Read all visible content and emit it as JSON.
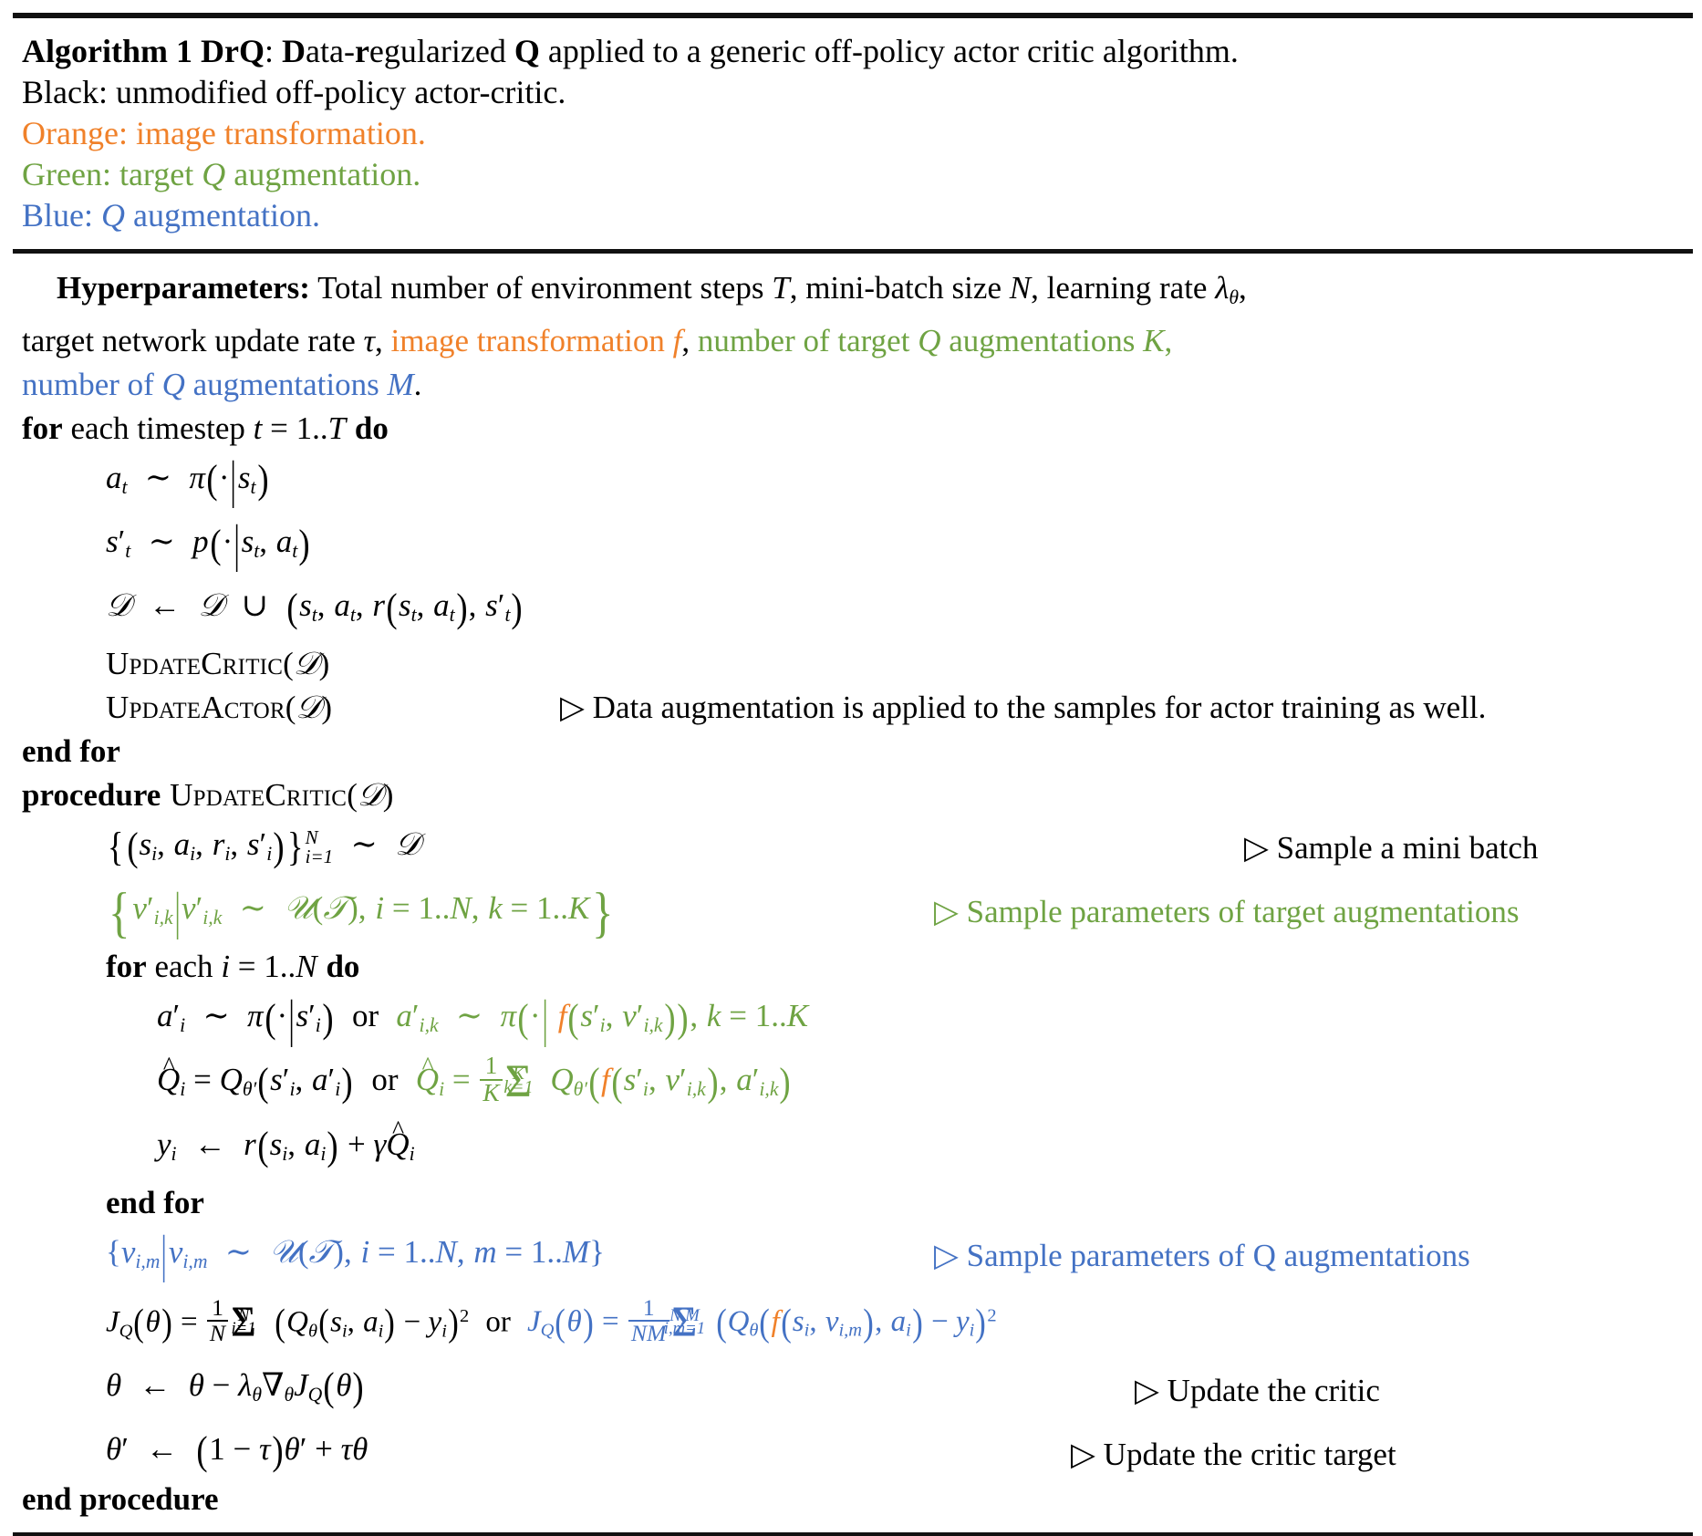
{
  "colors": {
    "black": "#000000",
    "orange": "#f0812a",
    "green": "#6fa343",
    "blue": "#4472c4",
    "rule": "#111111"
  },
  "header": {
    "title_bold_1": "Algorithm 1 DrQ",
    "title_colon": ":",
    "title_D": "D",
    "title_ata_dash": "ata-",
    "title_r": "r",
    "title_egularized": "egularized ",
    "title_Q": "Q",
    "title_rest": " applied to a generic off-policy actor critic algorithm.",
    "legend_black": "Black: unmodified off-policy actor-critic.",
    "legend_orange": "Orange: image transformation.",
    "legend_green_pre": "Green: target ",
    "legend_green_Q": "Q",
    "legend_green_post": " augmentation.",
    "legend_blue_pre": "Blue: ",
    "legend_blue_Q": "Q",
    "legend_blue_post": " augmentation."
  },
  "hyperparameters": {
    "label": "Hyperparameters:",
    "text_1": " Total number of environment steps ",
    "sym_T": "T",
    "text_2": ", mini-batch size ",
    "sym_N": "N",
    "text_3": ", learning rate ",
    "sym_lambda": "λ",
    "sym_lambda_sub": "θ",
    "text_4": ",",
    "text_5": "target network update rate ",
    "sym_tau": "τ",
    "text_6": ", ",
    "orange_text": "image transformation ",
    "orange_f": "f",
    "text_7": ", ",
    "green_text_a": "number of target ",
    "green_Q": "Q",
    "green_text_b": " augmentations ",
    "green_K": "K",
    "text_8": ",",
    "blue_text_a": "number of ",
    "blue_Q": "Q",
    "blue_text_b": " augmentations ",
    "blue_M": "M",
    "text_9": "."
  },
  "lines": {
    "for_timestep": {
      "kw_for": "for",
      "mid": " each timestep ",
      "t": "t",
      "eq": " = 1..",
      "T": "T",
      "kw_do": "do"
    },
    "a_t_sample": "a_t ~ π(·|s_t)",
    "s_t_sample": "s'_t ~ p(·|s_t, a_t)",
    "replay_update": "D ← D ∪ (s_t, a_t, r(s_t, a_t), s'_t)",
    "update_critic_call": "UPDATECRITIC(D)",
    "update_actor_call": "UPDATEACTOR(D)",
    "update_actor_comment": "Data augmentation is applied to the samples for actor training as well.",
    "end_for_1": "end for",
    "procedure_kw": "procedure",
    "procedure_name": "UpdateCritic",
    "procedure_arg": "(D)",
    "minibatch": "{(s_i, a_i, r_i, s'_i)}^N_{i=1} ~ D",
    "minibatch_comment": "Sample a mini batch",
    "target_aug_sample": "{ν'_{i,k} | ν'_{i,k} ~ U(T), i = 1..N, k = 1..K}",
    "target_aug_comment": "Sample parameters of target augmentations",
    "for_each_i": {
      "kw_for": "for",
      "mid": " each ",
      "i": "i",
      "eq": " = 1..",
      "N": "N",
      "kw_do": "do"
    },
    "action_line_plain": "a'_i ~ π(·|s'_i)",
    "or_1": "or",
    "action_line_aug": "a'_{i,k} ~ π(·| f(s'_i, ν'_{i,k})), k = 1..K",
    "qhat_plain": "Q̂_i = Q_θ'(s'_i, a'_i)",
    "or_2": "or",
    "qhat_aug": "Q̂_i = (1/K) Σ^K_{k=1} Q_θ'(f(s'_i, ν'_{i,k}), a'_{i,k})",
    "target_y": "y_i ← r(s_i, a_i) + γQ̂_i",
    "end_for_2": "end for",
    "q_aug_sample": "{ν_{i,m}|ν_{i,m} ~ U(T), i = 1..N, m = 1..M}",
    "q_aug_comment": "Sample parameters of Q augmentations",
    "critic_loss_plain": "J_Q(θ) = (1/N) Σ^N_{i=1} (Q_θ(s_i, a_i) − y_i)²",
    "or_3": "or",
    "critic_loss_aug": "J_Q(θ) = (1/NM) Σ^{N,M}_{i,m=1} (Q_θ(f(s_i, ν_{i,m}), a_i) − y_i)²",
    "theta_update": "θ ← θ − λ_θ ∇_θ J_Q(θ)",
    "theta_update_comment": "Update the critic",
    "theta_target_update": "θ' ← (1 − τ)θ' + τθ",
    "theta_target_comment": "Update the critic target",
    "end_procedure": "end procedure"
  },
  "symbols": {
    "triangle": "▷",
    "sim": "∼",
    "leftarrow": "←",
    "cup": "∪",
    "sum": "Σ",
    "nabla": "∇",
    "pi": "π",
    "theta": "θ",
    "tau": "τ",
    "gamma": "γ",
    "lambda": "λ",
    "nu": "ν",
    "cdot": "·",
    "minus": "−",
    "plus": "+",
    "equals": "=",
    "prime": "′",
    "hat": "^",
    "calD": "𝒟",
    "calU": "𝒰",
    "calT": "𝒯"
  }
}
